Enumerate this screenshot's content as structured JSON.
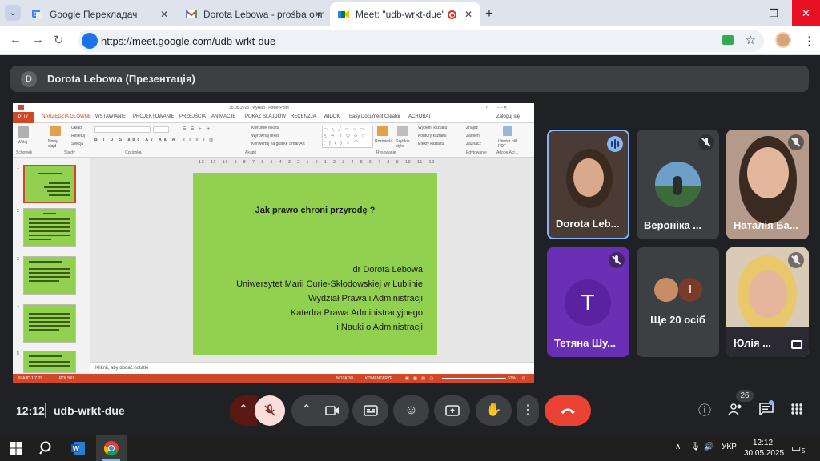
{
  "browser": {
    "tabs": [
      {
        "title": "Google Перекладач",
        "icon": "google-translate-icon"
      },
      {
        "title": "Dorota Lebowa - prośba o moż",
        "icon": "gmail-icon"
      },
      {
        "title": "Meet: \"udb-wrkt-due\"",
        "icon": "google-meet-icon"
      }
    ],
    "url": "https://meet.google.com/udb-wrkt-due"
  },
  "meet": {
    "presenter_initial": "D",
    "presenter_label": "Dorota Lebowa (Презентація)",
    "participants": [
      {
        "name": "Dorota Leb...",
        "state": "speaking"
      },
      {
        "name": "Вероніка ...",
        "state": "muted"
      },
      {
        "name": "Наталія Ба...",
        "state": "muted"
      },
      {
        "name": "Тетяна Шу...",
        "state": "muted",
        "initial": "T"
      },
      {
        "name": "Ще 20 осіб",
        "initial": "I"
      },
      {
        "name": "Юлія ...",
        "state": "muted"
      }
    ],
    "time": "12:12",
    "meeting_code": "udb-wrkt-due",
    "participants_count": "26"
  },
  "powerpoint": {
    "title": "30.05.2025 - wykład - PowerPoint",
    "ribbon_tabs": [
      "PLIK",
      "NARZĘDZIA GŁÓWNE",
      "WSTAWIANIE",
      "PROJEKTOWANIE",
      "PRZEJŚCIA",
      "ANIMACJE",
      "POKAZ SLAJDÓW",
      "RECENZJA",
      "WIDOK",
      "Easy Document Creator",
      "ACROBAT"
    ],
    "signin": "Zaloguj się",
    "ribbon_groups": [
      "Schowek",
      "Slajdy",
      "Czcionka",
      "Akapit",
      "Rysowanie",
      "Edytowanie",
      "Adobe Acr..."
    ],
    "ribbon_labels": {
      "paste": "Wklej",
      "new_slide": "Nowy slajd",
      "layout": "Układ",
      "reset": "Resetuj",
      "section": "Sekcja",
      "text_direction": "Kierunek tekstu",
      "align_text": "Wyrównaj tekst",
      "convert_smartart": "Konwertuj na grafikę SmartArt",
      "arrange": "Rozmieść",
      "quick_styles": "Szybkie style",
      "shape_fill": "Wypełn. kształtu",
      "shape_outline": "Kontury kształtu",
      "shape_effects": "Efekty kształtu",
      "find": "Znajdź",
      "replace": "Zamień",
      "select": "Zaznacz",
      "create_pdf": "Utwórz plik PDF"
    },
    "ruler": "· 12 · 11 · 10 · 9 · 8 · 7 · 6 · 5 · 4 · 3 · 2 · 1 · 0 · 1 · 2 · 3 · 4 · 5 · 6 · 7 · 8 · 9 · 10 · 11 · 12 ·",
    "thumb_numbers": [
      "1",
      "2",
      "3",
      "4",
      "5"
    ],
    "slide": {
      "title": "Jak prawo chroni przyrodę ?",
      "lines": [
        "dr Dorota Lebowa",
        "Uniwersytet Marii Curie-Skłodowskiej w Lublinie",
        "Wydział Prawa i Administracji",
        "Katedra Prawa Administracyjnego",
        "i Nauki o Administracji"
      ]
    },
    "notes": "Kliknij, aby dodać notatki",
    "status": {
      "slide": "SLAJD 1 Z 79",
      "lang": "POLSKI",
      "notes": "NOTATKI",
      "comments": "KOMENTARZE",
      "zoom": "67%"
    }
  },
  "taskbar": {
    "lang": "УКР",
    "time": "12:12",
    "date": "30.05.2025",
    "notifications": "5"
  },
  "colors": {
    "meet_bg": "#202124",
    "slide_green": "#92d050",
    "ppt_accent": "#d24726",
    "end_call": "#ea4335"
  }
}
